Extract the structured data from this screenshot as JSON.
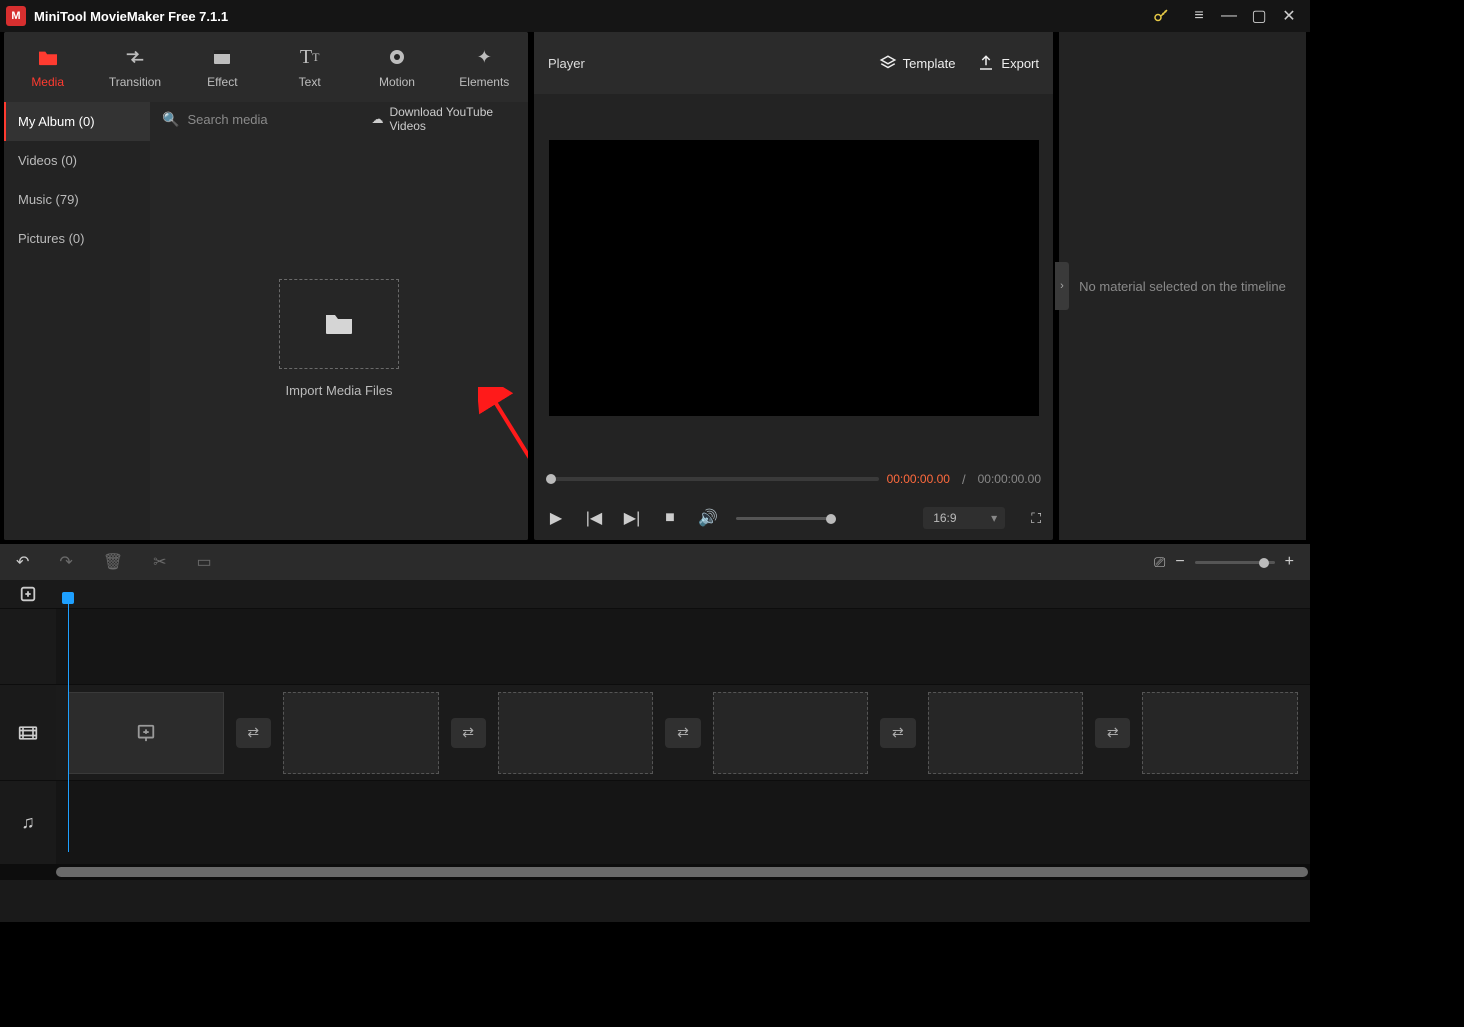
{
  "titlebar": {
    "title": "MiniTool MovieMaker Free 7.1.1"
  },
  "mainTabs": [
    {
      "label": "Media"
    },
    {
      "label": "Transition"
    },
    {
      "label": "Effect"
    },
    {
      "label": "Text"
    },
    {
      "label": "Motion"
    },
    {
      "label": "Elements"
    }
  ],
  "sidebar": [
    {
      "label": "My Album (0)"
    },
    {
      "label": "Videos (0)"
    },
    {
      "label": "Music (79)"
    },
    {
      "label": "Pictures (0)"
    }
  ],
  "mediaToolbar": {
    "searchPlaceholder": "Search media",
    "downloadYT": "Download YouTube Videos"
  },
  "import": {
    "label": "Import Media Files"
  },
  "player": {
    "title": "Player",
    "templateLabel": "Template",
    "exportLabel": "Export",
    "timeCurrent": "00:00:00.00",
    "timeTotal": "00:00:00.00",
    "aspect": "16:9"
  },
  "props": {
    "noSelection": "No material selected on the timeline"
  }
}
